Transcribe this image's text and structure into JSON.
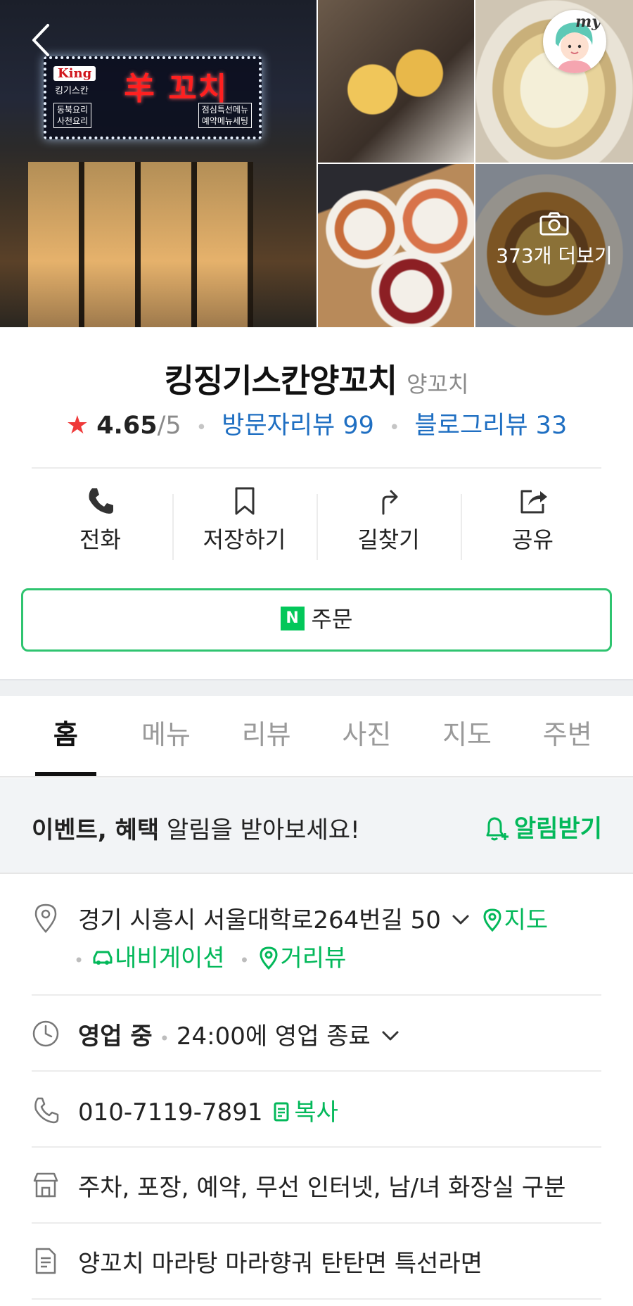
{
  "gallery": {
    "sign_king": "King",
    "sign_sub": "킹기스칸",
    "sign_main": "羊 꼬치",
    "sign_left": "동북요리\n사천요리",
    "sign_right": "점심특선메뉴\n예약메뉴세팅",
    "my_label": "my",
    "photo_more": "373개 더보기"
  },
  "place": {
    "name": "킹징기스칸양꼬치",
    "category": "양꼬치",
    "rating": "4.65",
    "rating_max": "/5",
    "visitor_reviews": "방문자리뷰 99",
    "blog_reviews": "블로그리뷰 33"
  },
  "actions": [
    {
      "label": "전화",
      "icon": "phone-icon"
    },
    {
      "label": "저장하기",
      "icon": "bookmark-icon"
    },
    {
      "label": "길찾기",
      "icon": "directions-icon"
    },
    {
      "label": "공유",
      "icon": "share-icon"
    }
  ],
  "order": {
    "badge": "N",
    "label": "주문"
  },
  "tabs": [
    "홈",
    "메뉴",
    "리뷰",
    "사진",
    "지도",
    "주변"
  ],
  "notice": {
    "bold": "이벤트, 혜택",
    "text": " 알림을 받아보세요!",
    "button": "알림받기"
  },
  "info": {
    "address": "경기 시흥시 서울대학로264번길 50",
    "map_link": "지도",
    "navi_link": "내비게이션",
    "street_view_link": "거리뷰",
    "hours_status": "영업 중",
    "hours_detail": "24:00에 영업 종료",
    "phone": "010-7119-7891",
    "copy_label": "복사",
    "amenities": "주차, 포장, 예약, 무선 인터넷, 남/녀 화장실 구분",
    "keywords": "양꼬치 마라탕 마라향궈 탄탄면 특선라면"
  },
  "colors": {
    "accent_green": "#03b85a",
    "link_blue": "#1f6fc2",
    "star_red": "#ef3a3a"
  }
}
